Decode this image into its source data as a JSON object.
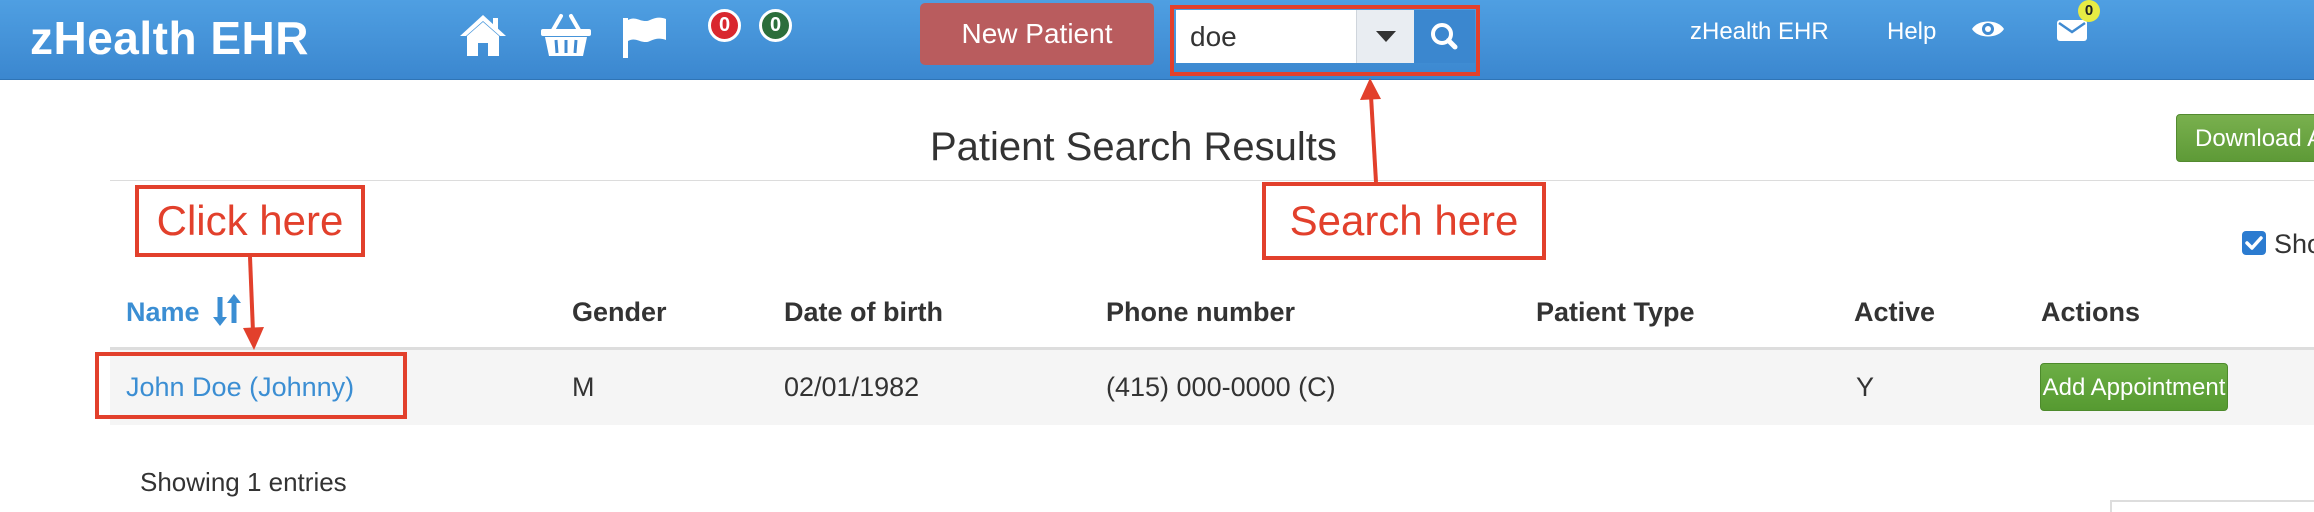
{
  "app": {
    "brand": "zHealth EHR"
  },
  "topbar": {
    "icons": [
      "home-icon",
      "basket-icon",
      "flag-icon"
    ],
    "badge_red": "0",
    "badge_green": "0",
    "new_patient_label": "New Patient",
    "search": {
      "value": "doe"
    },
    "right_links": {
      "brand": "zHealth EHR",
      "help": "Help"
    },
    "mail_count": "0"
  },
  "main": {
    "title": "Patient Search Results",
    "download_label": "Download A",
    "show_label": "Sho",
    "table": {
      "columns": [
        "Name",
        "Gender",
        "Date of birth",
        "Phone number",
        "Patient Type",
        "Active",
        "Actions"
      ],
      "rows": [
        {
          "name": "John Doe  (Johnny)",
          "gender": "M",
          "dob": "02/01/1982",
          "phone": "(415) 000-0000 (C)",
          "patient_type": "",
          "active": "Y",
          "action": "Add Appointment"
        }
      ]
    },
    "footer": "Showing 1 entries"
  },
  "annotations": {
    "click": "Click here",
    "search": "Search here"
  },
  "colors": {
    "topbar": "#3b87cf",
    "link": "#3b8ed3",
    "new_patient": "#b95c5e",
    "action_green": "#5e9a37",
    "annotation": "#e2402c"
  }
}
